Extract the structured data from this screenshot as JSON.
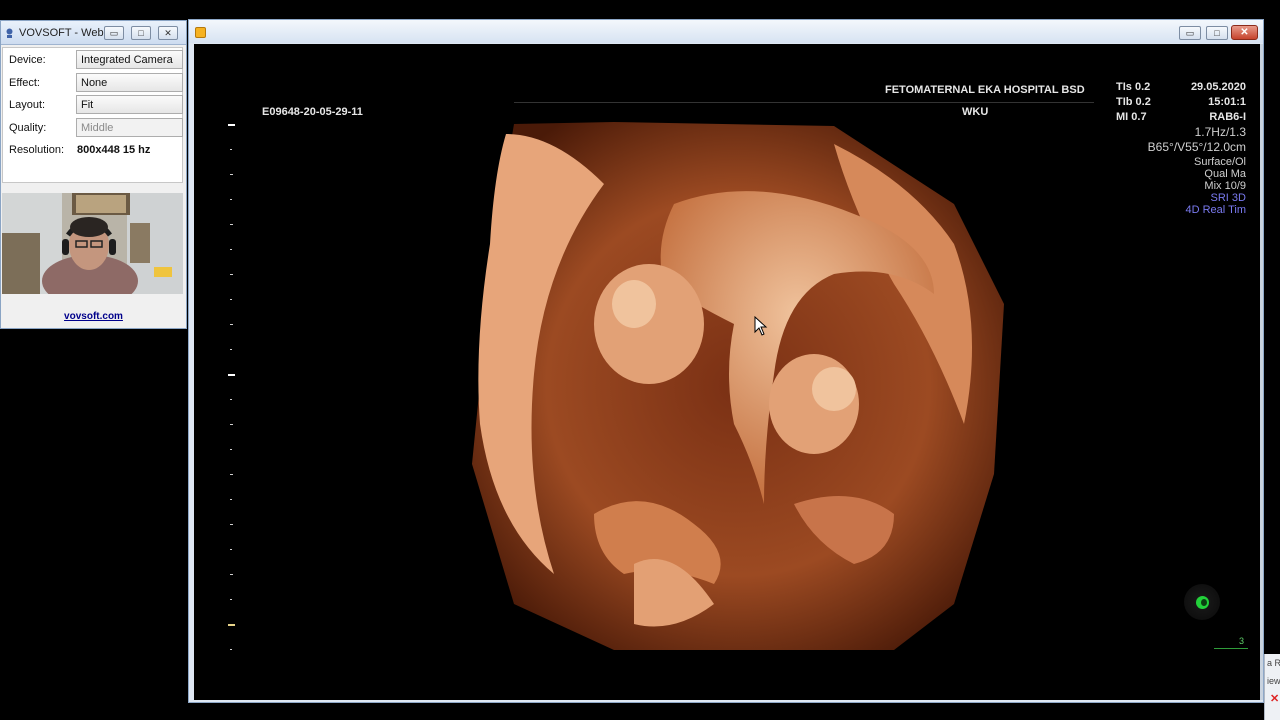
{
  "webcam_app": {
    "title": "VOVSOFT - Web...",
    "buttons": {
      "minimize": "▭",
      "maximize": "□",
      "close": "✕"
    },
    "fields": [
      {
        "label": "Device:",
        "value": "Integrated Camera"
      },
      {
        "label": "Effect:",
        "value": "None"
      },
      {
        "label": "Layout:",
        "value": "Fit"
      },
      {
        "label": "Quality:",
        "value": "Middle"
      }
    ],
    "resolution": {
      "label": "Resolution:",
      "value": "800x448 15 hz"
    },
    "link": "vovsoft.com"
  },
  "viewer": {
    "buttons": {
      "minimize": "▭",
      "maximize": "□",
      "close": "✕"
    },
    "overlay": {
      "patient_id": "E09648-20-05-29-11",
      "hospital": "FETOMATERNAL EKA HOSPITAL BSD",
      "operator": "WKU",
      "tis": "TIs  0.2",
      "tib": "TIb  0.2",
      "mi": "MI  0.7",
      "date": "29.05.2020",
      "time": "15:01:1",
      "probe": "RAB6-I",
      "frequency": "1.7Hz/1.3",
      "volume_angle": "B65°/V55°/12.0cm",
      "render_mode": "Surface/Ol",
      "quality": "Qual Ma",
      "mix": "Mix 10/9",
      "sri": "SRI 3D",
      "mode": "4D Real Tim",
      "scale_label": "3"
    }
  },
  "background_window": {
    "line1": "a R",
    "line2": "iew"
  },
  "colors": {
    "accent_blue_text": "#7a7af0",
    "trackball_green": "#22d13a",
    "link_color": "#00008b",
    "close_red": "#c6432d"
  }
}
